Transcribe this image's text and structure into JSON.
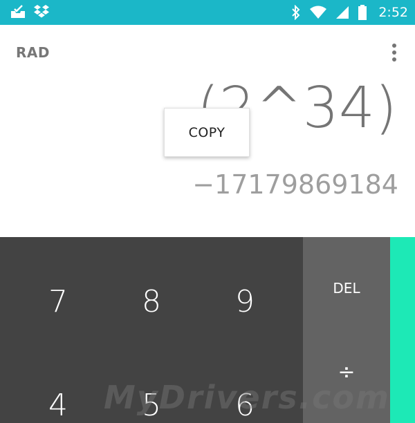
{
  "status_bar": {
    "time": "2:52",
    "left_icons": [
      "inbox-check-icon",
      "dropbox-icon"
    ],
    "right_icons": [
      "bluetooth-icon",
      "wifi-icon",
      "cell-signal-icon",
      "battery-icon"
    ],
    "background_color": "#1bb7c8"
  },
  "display": {
    "mode": "RAD",
    "formula": "(2^34)",
    "result": "−17179869184",
    "menu_icon": "overflow-menu-icon"
  },
  "popup": {
    "copy_label": "COPY"
  },
  "keypad": {
    "row1": [
      "7",
      "8",
      "9"
    ],
    "row2": [
      "4",
      "5",
      "6"
    ],
    "del_label": "DEL",
    "divide_label": "÷",
    "numpad_color": "#434343",
    "ops_color": "#636363",
    "advanced_color": "#1de9b6"
  },
  "watermark": "MyDrivers.com"
}
